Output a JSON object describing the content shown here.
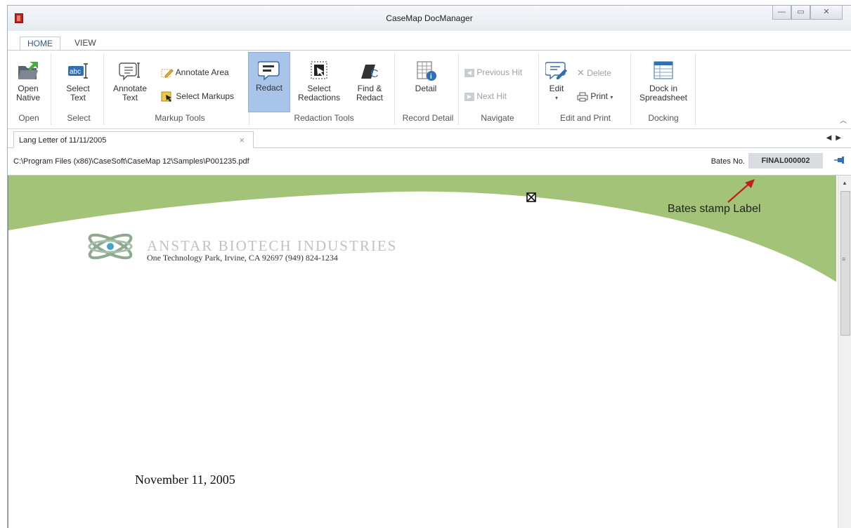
{
  "window": {
    "title": "CaseMap DocManager",
    "controls": [
      "—",
      "▭",
      "✕"
    ]
  },
  "tabs": {
    "home": "HOME",
    "view": "VIEW"
  },
  "ribbon": {
    "open_native": [
      "Open",
      "Native"
    ],
    "select_text": [
      "Select",
      "Text"
    ],
    "annotate_text": [
      "Annotate",
      "Text"
    ],
    "annotate_area": "Annotate Area",
    "select_markups": "Select Markups",
    "redact": "Redact",
    "select_redactions": [
      "Select",
      "Redactions"
    ],
    "find_redact": [
      "Find &",
      "Redact"
    ],
    "detail": "Detail",
    "previous_hit": "Previous Hit",
    "next_hit": "Next Hit",
    "edit": "Edit",
    "delete": "Delete",
    "print": "Print",
    "dock": [
      "Dock in",
      "Spreadsheet"
    ],
    "groups": {
      "open": "Open",
      "select": "Select",
      "markup_tools": "Markup Tools",
      "redaction_tools": "Redaction Tools",
      "record_detail": "Record Detail",
      "navigate": "Navigate",
      "edit_and_print": "Edit and Print",
      "docking": "Docking"
    }
  },
  "doc_tab": {
    "label": "Lang Letter of 11/11/2005"
  },
  "pathbar": {
    "path": "C:\\Program Files (x86)\\CaseSoft\\CaseMap 12\\Samples\\P001235.pdf",
    "bates_label": "Bates No.",
    "bates_value": "FINAL000002"
  },
  "document": {
    "company": "ANSTAR BIOTECH INDUSTRIES",
    "address": "One Technology Park, Irvine, CA  92697  (949) 824-1234",
    "date": "November 11, 2005",
    "annotation": "Bates stamp Label"
  },
  "colors": {
    "accent": "#2b579a",
    "header_green": "#a3c378",
    "arrow_red": "#c0201b"
  }
}
